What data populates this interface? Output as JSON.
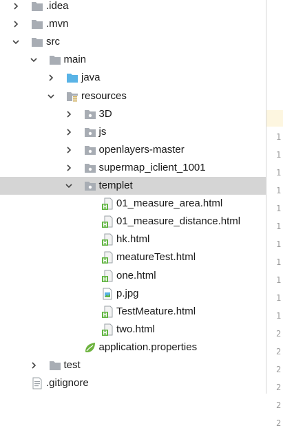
{
  "project_tree": {
    "items": [
      {
        "label": ".idea",
        "icon": "folder-icon",
        "arrow": "collapsed",
        "depth": 0
      },
      {
        "label": ".mvn",
        "icon": "folder-icon",
        "arrow": "collapsed",
        "depth": 0
      },
      {
        "label": "src",
        "icon": "folder-icon",
        "arrow": "expanded",
        "depth": 0
      },
      {
        "label": "main",
        "icon": "folder-icon",
        "arrow": "expanded",
        "depth": 1
      },
      {
        "label": "java",
        "icon": "source-folder-icon",
        "arrow": "collapsed",
        "depth": 2
      },
      {
        "label": "resources",
        "icon": "resources-folder-icon",
        "arrow": "expanded",
        "depth": 2
      },
      {
        "label": "3D",
        "icon": "package-folder-icon",
        "arrow": "collapsed",
        "depth": 3
      },
      {
        "label": "js",
        "icon": "package-folder-icon",
        "arrow": "collapsed",
        "depth": 3
      },
      {
        "label": "openlayers-master",
        "icon": "package-folder-icon",
        "arrow": "collapsed",
        "depth": 3
      },
      {
        "label": "supermap_iclient_1001",
        "icon": "package-folder-icon",
        "arrow": "collapsed",
        "depth": 3
      },
      {
        "label": "templet",
        "icon": "package-folder-icon",
        "arrow": "expanded",
        "depth": 3,
        "selected": true
      },
      {
        "label": "01_measure_area.html",
        "icon": "html-file-icon",
        "arrow": "none",
        "depth": 4
      },
      {
        "label": "01_measure_distance.html",
        "icon": "html-file-icon",
        "arrow": "none",
        "depth": 4
      },
      {
        "label": "hk.html",
        "icon": "html-file-icon",
        "arrow": "none",
        "depth": 4
      },
      {
        "label": "meatureTest.html",
        "icon": "html-file-icon",
        "arrow": "none",
        "depth": 4
      },
      {
        "label": "one.html",
        "icon": "html-file-icon",
        "arrow": "none",
        "depth": 4
      },
      {
        "label": "p.jpg",
        "icon": "image-file-icon",
        "arrow": "none",
        "depth": 4
      },
      {
        "label": "TestMeature.html",
        "icon": "html-file-icon",
        "arrow": "none",
        "depth": 4
      },
      {
        "label": "two.html",
        "icon": "html-file-icon",
        "arrow": "none",
        "depth": 4
      },
      {
        "label": "application.properties",
        "icon": "spring-properties-icon",
        "arrow": "none",
        "depth": 3
      },
      {
        "label": "test",
        "icon": "folder-icon",
        "arrow": "collapsed",
        "depth": 1
      },
      {
        "label": ".gitignore",
        "icon": "text-file-icon",
        "arrow": "none",
        "depth": 0
      }
    ]
  },
  "gutter": {
    "line_numbers": [
      "1",
      "1",
      "1",
      "1",
      "1",
      "1",
      "1",
      "1",
      "1",
      "1",
      "1",
      "2",
      "2",
      "2",
      "2",
      "2",
      "2"
    ],
    "highlight_color": "#fdf6e0"
  },
  "colors": {
    "selection": "#d5d5d5",
    "folder": "#a8adb4",
    "source_folder": "#59b3e6",
    "html_green": "#62b543",
    "spring_green": "#6db33f"
  }
}
